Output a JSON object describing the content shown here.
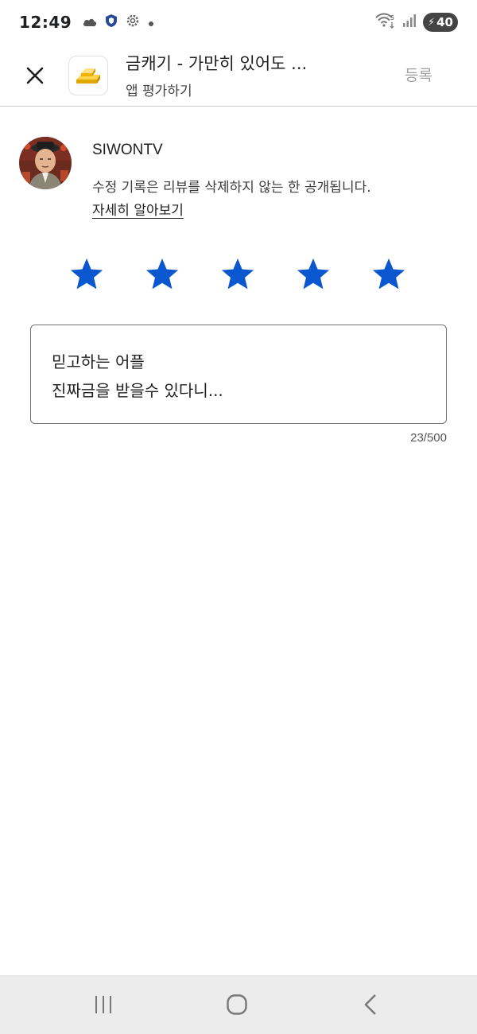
{
  "status_bar": {
    "time": "12:49",
    "battery_level": "40",
    "icons": [
      "cloud-icon",
      "shield-icon",
      "gear-icon",
      "dot-icon",
      "wifi-icon",
      "signal-icon",
      "battery-icon"
    ]
  },
  "header": {
    "title": "금캐기 - 가만히 있어도 ...",
    "subtitle": "앱 평가하기",
    "submit_label": "등록"
  },
  "profile": {
    "user_name": "SIWONTV",
    "notice": "수정 기록은 리뷰를 삭제하지 않는 한 공개됩니다.",
    "learn_more": "자세히 알아보기"
  },
  "rating": {
    "value": 5,
    "max": 5,
    "star_color": "#0b57d0"
  },
  "review": {
    "lines": [
      "믿고하는 어플",
      "진짜금을 받을수 있다니..."
    ],
    "char_count": "23/500"
  }
}
